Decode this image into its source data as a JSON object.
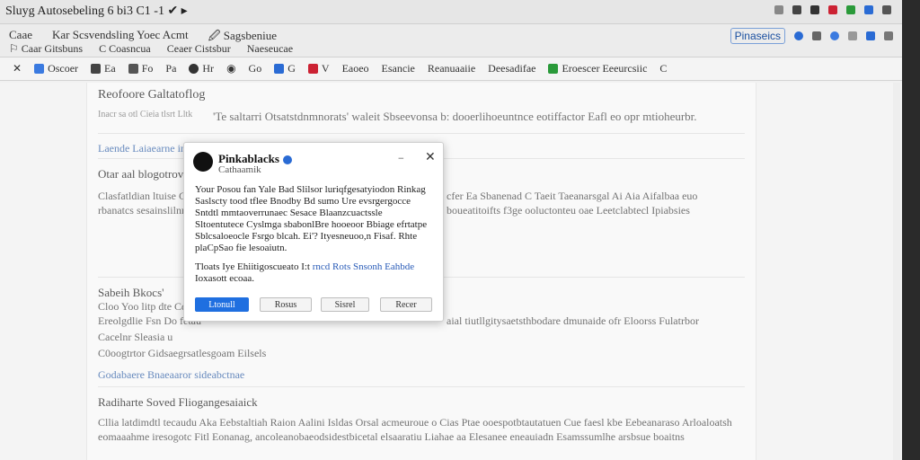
{
  "window": {
    "title": "Sluyg Autosebeling 6 bi3 C1 -1 ✔ ▸",
    "title_icons": [
      "gear-icon",
      "flag-icon",
      "shield-icon",
      "red-square-icon",
      "green-square-icon",
      "blue-square-icon",
      "menu-icon"
    ]
  },
  "address": {
    "row1": [
      "Caae",
      "Kar Scsvendsling Yoec Acmt",
      "🖉 Sagsbeniue"
    ],
    "row2": [
      "⚐ Caar Gitsbuns",
      "C Coasncua",
      "Ceaer Cistsbur",
      "Naeseucae"
    ],
    "right_badge": "Pinaseics",
    "right_icons": [
      "blue-dot-icon",
      "grid-icon",
      "blue-circle-icon",
      "square-icon",
      "blue-square-icon",
      "plus-icon"
    ]
  },
  "toolbar": {
    "items": [
      "✕",
      "Oscoer",
      "Ea",
      "Fo",
      "Pa",
      "Hr",
      "◉",
      "Go",
      "G",
      "V",
      "Eaoeo",
      "Esancie",
      "Reanuaaiie",
      "Deesadifae",
      "Eroescer Eeeurcsiic",
      "C"
    ]
  },
  "document": {
    "heading1": "Reofoore Galtatoflog",
    "meta": "Inacr sa otl Cieia tlsrt Lltk",
    "intro": "'Te saltarri Otsatstdnmnorats' waleit Sbseevonsa b: dooerlihoeuntnce eotiffactor Eafl eo opr mtioheurbr.",
    "link1": "Laende Laiaearne ine",
    "subhead1": "Otar aal blogotrovee",
    "para1": "Clasfatldian ltuise Git sea Lisesiimg sbs ofelbhiocoos rbanatcs sesainslilnm soiaotutdbantiloal sfeltheiibobutsouo",
    "para1_right": "cfer Ea Sbanenad C Taeit  Taeanarsgal Ai Aia Aifalbaa euo boueatitoifts f3ge ooluctonteu oae Leetclabtecl Ipiabsies",
    "subhead2": "Sabeih Bkocs'",
    "list1": "Cloo Yoo litp dte Cdhc",
    "list2": "Ereolgdlie Fsn Do fetau",
    "list2_right": "aial tiutllgitysaetsthbodare dmunaide ofr Eloorss Fulatrbor",
    "list3": "Cacelnr Sleasia u",
    "list4": "C0oogtrtor Gidsaegrsatlesgoam Eilsels",
    "link2": "Godabaere Bnaeaaror sideabctnae",
    "subhead3": "Radiharte Soved Fliogangesaiaick",
    "para3": "Cllia latdimdtl tecaudu Aka Eebstaltiah Raion Aalini Isldas Orsal acmeuroue o Cias Ptae ooespotbtautatuen Cue faesl kbe Eebeanaraso Arloaloatsh eomaaahme iresogotc Fitl Eonanag, ancoleanobaeodsidestbicetal elsaaratiu Liahae aa Elesanee eneauiadn Esamssumlhe arsbsue boaitns"
  },
  "dialog": {
    "title": "Pinkablacks",
    "subtitle": "Cathaamik",
    "minimize": "−",
    "close": "✕",
    "body": "Your Posou fan Yale Bad Slilsor luriqfgesatyiodon Rinkag Saslscty tood tflee Bnodby Bd sumo Ure evsrgergocce Sntdtl mmtaoverrunaec Sesace Blaanzcuactssle Sltoentutece Cyslmga sbabonlBre hooeoor Bbiage efrtatpe Sblcsaloeocle Fsrgo blcah. Ei'? Ityesneuoo,n Fisaf. Rhte plaCpSao fie lesoaiutn.",
    "body2_prefix": "Tloats Iye Ehiitigoscueato I:t ",
    "body2_link": "rncd Rots Snsonh Eahbde",
    "body2_suffix": " Ioxasott ecoaa.",
    "buttons": [
      "Ltonull",
      "Rosus",
      "Sisrel",
      "Recer"
    ]
  },
  "colors": {
    "accent": "#1f6fe0",
    "link": "#3563a8",
    "dialog_bg": "#ffffff",
    "page_bg": "#f7f7f7"
  }
}
